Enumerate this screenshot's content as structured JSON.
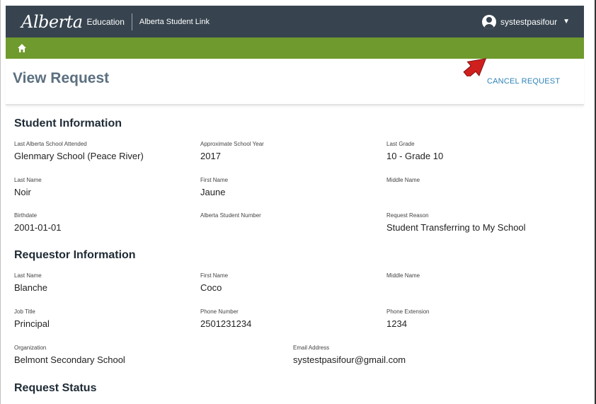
{
  "header": {
    "logo_text": "Alberta",
    "logo_sub": "Education",
    "app_name": "Alberta Student Link",
    "username": "systestpasifour",
    "caret": "▼"
  },
  "nav": {
    "home_icon": "home-icon"
  },
  "page": {
    "title": "View Request",
    "cancel_label": "CANCEL REQUEST"
  },
  "student": {
    "title": "Student Information",
    "last_school_label": "Last Alberta School Attended",
    "last_school_value": "Glenmary School (Peace River)",
    "school_year_label": "Approximate School Year",
    "school_year_value": "2017",
    "last_grade_label": "Last Grade",
    "last_grade_value": "10 - Grade 10",
    "last_name_label": "Last Name",
    "last_name_value": "Noir",
    "first_name_label": "First Name",
    "first_name_value": "Jaune",
    "middle_name_label": "Middle Name",
    "middle_name_value": "",
    "birthdate_label": "Birthdate",
    "birthdate_value": "2001-01-01",
    "asn_label": "Alberta Student Number",
    "asn_value": "",
    "reason_label": "Request Reason",
    "reason_value": "Student Transferring to My School"
  },
  "requestor": {
    "title": "Requestor Information",
    "last_name_label": "Last Name",
    "last_name_value": "Blanche",
    "first_name_label": "First Name",
    "first_name_value": "Coco",
    "middle_name_label": "Middle Name",
    "middle_name_value": "",
    "job_title_label": "Job Title",
    "job_title_value": "Principal",
    "phone_label": "Phone Number",
    "phone_value": "2501231234",
    "ext_label": "Phone Extension",
    "ext_value": "1234",
    "org_label": "Organization",
    "org_value": "Belmont Secondary School",
    "email_label": "Email Address",
    "email_value": "systestpasifour@gmail.com"
  },
  "status": {
    "title": "Request Status"
  },
  "colors": {
    "topbar": "#37444f",
    "greenbar": "#6f9a2d",
    "title": "#5b6f80",
    "link": "#2f83b8",
    "arrow": "#d0201e"
  }
}
